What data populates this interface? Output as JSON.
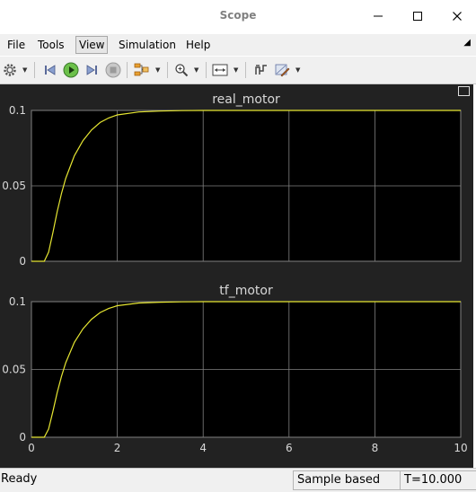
{
  "window": {
    "title": "Scope"
  },
  "menu": [
    "File",
    "Tools",
    "View",
    "Simulation",
    "Help"
  ],
  "toolbar_icons": [
    "settings-icon",
    "step-back-icon",
    "run-icon",
    "step-forward-icon",
    "stop-icon",
    "highlight-icon",
    "zoom-in-icon",
    "fit-axes-icon",
    "triggers-icon",
    "style-icon"
  ],
  "colors": {
    "signal": "#e6e632",
    "axes_bg": "#000000",
    "figure_bg": "#222222",
    "grid": "#808080",
    "text": "#d8d8d8"
  },
  "status": {
    "left": "Ready",
    "mode": "Sample based",
    "time": "T=10.000"
  },
  "chart_data": [
    {
      "type": "line",
      "title": "real_motor",
      "xlim": [
        0,
        10
      ],
      "ylim": [
        0,
        0.1
      ],
      "yticks": [
        "0",
        "0.05",
        "0.1"
      ],
      "grid": true,
      "series": [
        {
          "x": [
            0,
            0.3,
            0.4,
            0.5,
            0.6,
            0.7,
            0.8,
            1.0,
            1.2,
            1.4,
            1.6,
            1.8,
            2.0,
            2.5,
            3.0,
            3.5,
            4.0,
            5.0,
            10.0
          ],
          "y": [
            0,
            0,
            0.006,
            0.019,
            0.033,
            0.045,
            0.055,
            0.07,
            0.08,
            0.087,
            0.092,
            0.095,
            0.097,
            0.099,
            0.0996,
            0.0999,
            0.1,
            0.1,
            0.1
          ]
        }
      ]
    },
    {
      "type": "line",
      "title": "tf_motor",
      "xlim": [
        0,
        10
      ],
      "ylim": [
        0,
        0.1
      ],
      "xticks": [
        "0",
        "2",
        "4",
        "6",
        "8",
        "10"
      ],
      "yticks": [
        "0",
        "0.05",
        "0.1"
      ],
      "grid": true,
      "series": [
        {
          "x": [
            0,
            0.3,
            0.4,
            0.5,
            0.6,
            0.7,
            0.8,
            1.0,
            1.2,
            1.4,
            1.6,
            1.8,
            2.0,
            2.5,
            3.0,
            3.5,
            4.0,
            5.0,
            10.0
          ],
          "y": [
            0,
            0,
            0.006,
            0.019,
            0.033,
            0.045,
            0.055,
            0.07,
            0.08,
            0.087,
            0.092,
            0.095,
            0.097,
            0.099,
            0.0996,
            0.0999,
            0.1,
            0.1,
            0.1
          ]
        }
      ]
    }
  ]
}
